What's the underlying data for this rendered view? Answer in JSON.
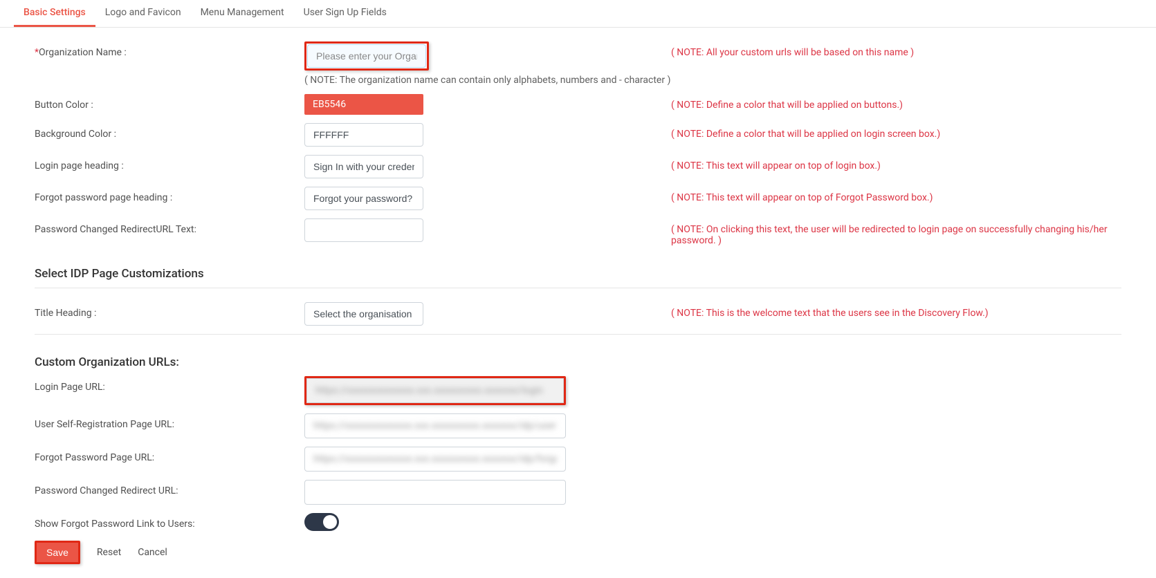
{
  "tabs": [
    "Basic Settings",
    "Logo and Favicon",
    "Menu Management",
    "User Sign Up Fields"
  ],
  "active_tab": "Basic Settings",
  "fields": {
    "org_name": {
      "label": "Organization Name :",
      "placeholder": "Please enter your Organi",
      "value": "",
      "subnote": "( NOTE: The organization name can contain only alphabets, numbers and - character )",
      "note": "( NOTE: All your custom urls will be based on this name )"
    },
    "button_color": {
      "label": "Button Color :",
      "value": "EB5546",
      "note": "( NOTE: Define a color that will be applied on buttons.)"
    },
    "background_color": {
      "label": "Background Color :",
      "value": "FFFFFF",
      "note": "( NOTE: Define a color that will be applied on login screen box.)"
    },
    "login_heading": {
      "label": "Login page heading :",
      "value": "Sign In with your credent",
      "note": "( NOTE: This text will appear on top of login box.)"
    },
    "forgot_heading": {
      "label": "Forgot password page heading :",
      "value": "Forgot your password?",
      "note": "( NOTE: This text will appear on top of Forgot Password box.)"
    },
    "pwd_redirect_text": {
      "label": "Password Changed RedirectURL Text:",
      "value": "",
      "note": "( NOTE: On clicking this text, the user will be redirected to login page on successfully changing his/her password. )"
    }
  },
  "section_idp_title": "Select IDP Page Customizations",
  "idp": {
    "title_heading": {
      "label": "Title Heading :",
      "value": "Select the organisation y",
      "note": "( NOTE: This is the welcome text that the users see in the Discovery Flow.)"
    }
  },
  "section_urls_title": "Custom Organization URLs:",
  "urls": {
    "login": {
      "label": "Login Page URL:",
      "value": "https://xxxxxxxxxxxxxx.xxx.xxxxxxxxxx.xxxxxxx/login"
    },
    "self_reg": {
      "label": "User Self-Registration Page URL:",
      "value": "https://xxxxxxxxxxxxxx.xxx.xxxxxxxxxx.xxxxxxx/idp/user-su"
    },
    "forgot": {
      "label": "Forgot Password Page URL:",
      "value": "https://xxxxxxxxxxxxxx.xxx.xxxxxxxxxx.xxxxxxx/idp/forgotp"
    },
    "pwd_redirect": {
      "label": "Password Changed Redirect URL:",
      "value": ""
    },
    "show_forgot": {
      "label": "Show Forgot Password Link to Users:",
      "on": true
    }
  },
  "actions": {
    "save": "Save",
    "reset": "Reset",
    "cancel": "Cancel"
  }
}
